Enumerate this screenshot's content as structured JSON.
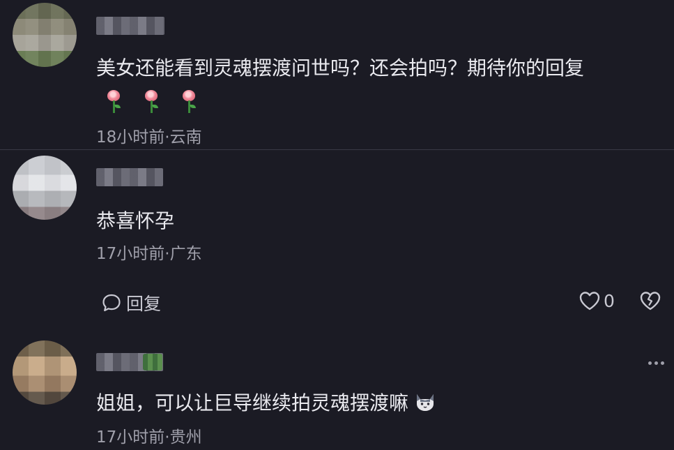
{
  "comments": [
    {
      "text": "美女还能看到灵魂摆渡问世吗？还会拍吗？期待你的回复",
      "emoji": [
        "rose-emoji",
        "rose-emoji",
        "rose-emoji"
      ],
      "meta": "18小时前·云南"
    },
    {
      "text": "恭喜怀孕",
      "meta": "17小时前·广东",
      "actions": {
        "reply_label": "回复",
        "like_count": "0"
      }
    },
    {
      "text": "姐姐，可以让巨导继续拍灵魂摆渡嘛",
      "emoji": "cat-emoji",
      "meta": "17小时前·贵州"
    }
  ],
  "colors": {
    "background": "#1b1b24",
    "text": "#eaeaef",
    "meta": "#a0a0ab",
    "divider": "#3a3a46"
  }
}
